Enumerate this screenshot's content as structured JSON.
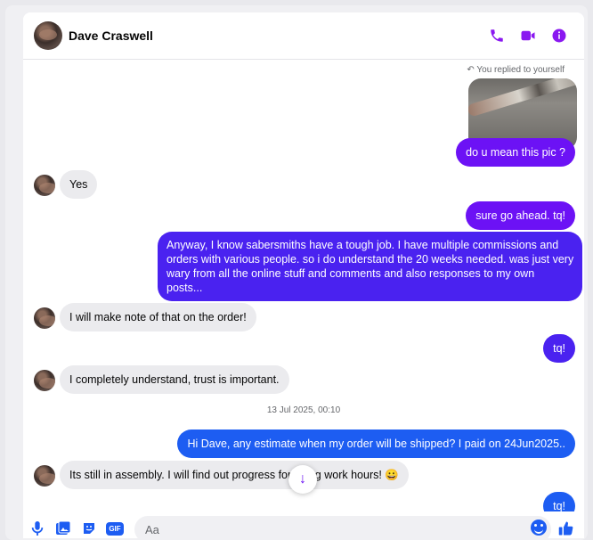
{
  "header": {
    "contact_name": "Dave Craswell",
    "icons": [
      "phone-icon",
      "video-camera-icon",
      "info-icon"
    ],
    "accent_color": "#8a18f0"
  },
  "conversation": {
    "reply_note": "You replied to yourself",
    "timestamp": "13 Jul 2025, 00:10",
    "messages": [
      {
        "sender": "me",
        "type": "image",
        "text": ""
      },
      {
        "sender": "me",
        "text": "do u mean this pic ?"
      },
      {
        "sender": "them",
        "text": "Yes"
      },
      {
        "sender": "me",
        "text": "sure go ahead. tq!"
      },
      {
        "sender": "me",
        "lines": [
          "Anyway, I know sabersmiths have a tough job. I have multiple commissions and",
          "orders with various people. so i do understand the 20 weeks needed. was just very",
          "wary from all the online stuff and comments and also responses to my own",
          "posts..."
        ]
      },
      {
        "sender": "them",
        "text": "I will make note of that on the order!"
      },
      {
        "sender": "me",
        "text": "tq!"
      },
      {
        "sender": "them",
        "text": "I completely understand, trust is important."
      },
      {
        "sender": "me",
        "text": "Hi Dave, any estimate when my order will be shipped? I paid on 24Jun2025.."
      },
      {
        "sender": "them",
        "text_start": "Its still in assembly. I will find out progress for",
        "text_end": "luring work hours! 😀"
      },
      {
        "sender": "me",
        "text": "tq!"
      }
    ]
  },
  "composer": {
    "placeholder": "Aa",
    "icons": [
      "microphone-icon",
      "photo-icon",
      "sticker-icon",
      "gif-icon",
      "emoji-icon",
      "thumbs-up-icon"
    ],
    "gif_label": "GIF"
  }
}
